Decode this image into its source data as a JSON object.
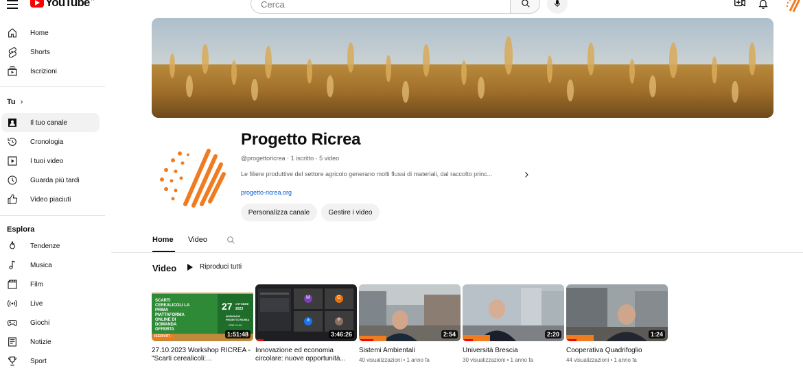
{
  "topbar": {
    "logo_text": "YouTube",
    "logo_sup": "IT",
    "search_placeholder": "Cerca"
  },
  "sidebar": {
    "main": [
      {
        "label": "Home",
        "icon": "home-icon"
      },
      {
        "label": "Shorts",
        "icon": "shorts-icon"
      },
      {
        "label": "Iscrizioni",
        "icon": "subscriptions-icon"
      }
    ],
    "you_heading": "Tu",
    "you": [
      {
        "label": "Il tuo canale",
        "icon": "channel-icon"
      },
      {
        "label": "Cronologia",
        "icon": "history-icon"
      },
      {
        "label": "I tuoi video",
        "icon": "your-videos-icon"
      },
      {
        "label": "Guarda più tardi",
        "icon": "watch-later-icon"
      },
      {
        "label": "Video piaciuti",
        "icon": "liked-icon"
      }
    ],
    "explore_heading": "Esplora",
    "explore": [
      {
        "label": "Tendenze",
        "icon": "trending-icon"
      },
      {
        "label": "Musica",
        "icon": "music-icon"
      },
      {
        "label": "Film",
        "icon": "film-icon"
      },
      {
        "label": "Live",
        "icon": "live-icon"
      },
      {
        "label": "Giochi",
        "icon": "gaming-icon"
      },
      {
        "label": "Notizie",
        "icon": "news-icon"
      },
      {
        "label": "Sport",
        "icon": "sport-icon"
      }
    ]
  },
  "channel": {
    "name": "Progetto Ricrea",
    "meta": "@progettoricrea · 1 iscritto · 5 video",
    "description": "Le filiere produttive del settore agricolo generano molti flussi di materiali, dal raccolto princ...",
    "link": "progetto-ricrea.org",
    "customize_label": "Personalizza canale",
    "manage_label": "Gestire i video",
    "accent_color": "#f07c22"
  },
  "tabs": {
    "home": "Home",
    "video": "Video"
  },
  "section": {
    "title": "Video",
    "play_all": "Riproduci tutti"
  },
  "videos": [
    {
      "title": "27.10.2023 Workshop RICREA - \"Scarti cerealicoli:...",
      "meta": "",
      "duration": "1:51:48",
      "thumb_text": {
        "heading": "SCARTI CEREALICOLI LA PRIMA PIATTAFORMA ONLINE DI DOMANDA OFFERTA",
        "day": "27",
        "month": "OTTOBRE",
        "year": "2023",
        "badge": "WORKSHOP PROGETTO RICREA",
        "time": "ORE 11:00",
        "cta": "ISCRIVITI"
      }
    },
    {
      "title": "Innovazione ed economia circolare: nuove opportunità...",
      "meta": "",
      "duration": "3:46:26",
      "thumb_text": {
        "tiles": [
          "M",
          "G",
          "a",
          "F"
        ]
      }
    },
    {
      "title": "Sistemi Ambientali",
      "meta": "40 visualizzazioni • 1 anno fa",
      "duration": "2:54"
    },
    {
      "title": "Università Brescia",
      "meta": "30 visualizzazioni • 1 anno fa",
      "duration": "2:20"
    },
    {
      "title": "Cooperativa Quadrifoglio",
      "meta": "44 visualizzazioni • 1 anno fa",
      "duration": "1:24"
    }
  ]
}
